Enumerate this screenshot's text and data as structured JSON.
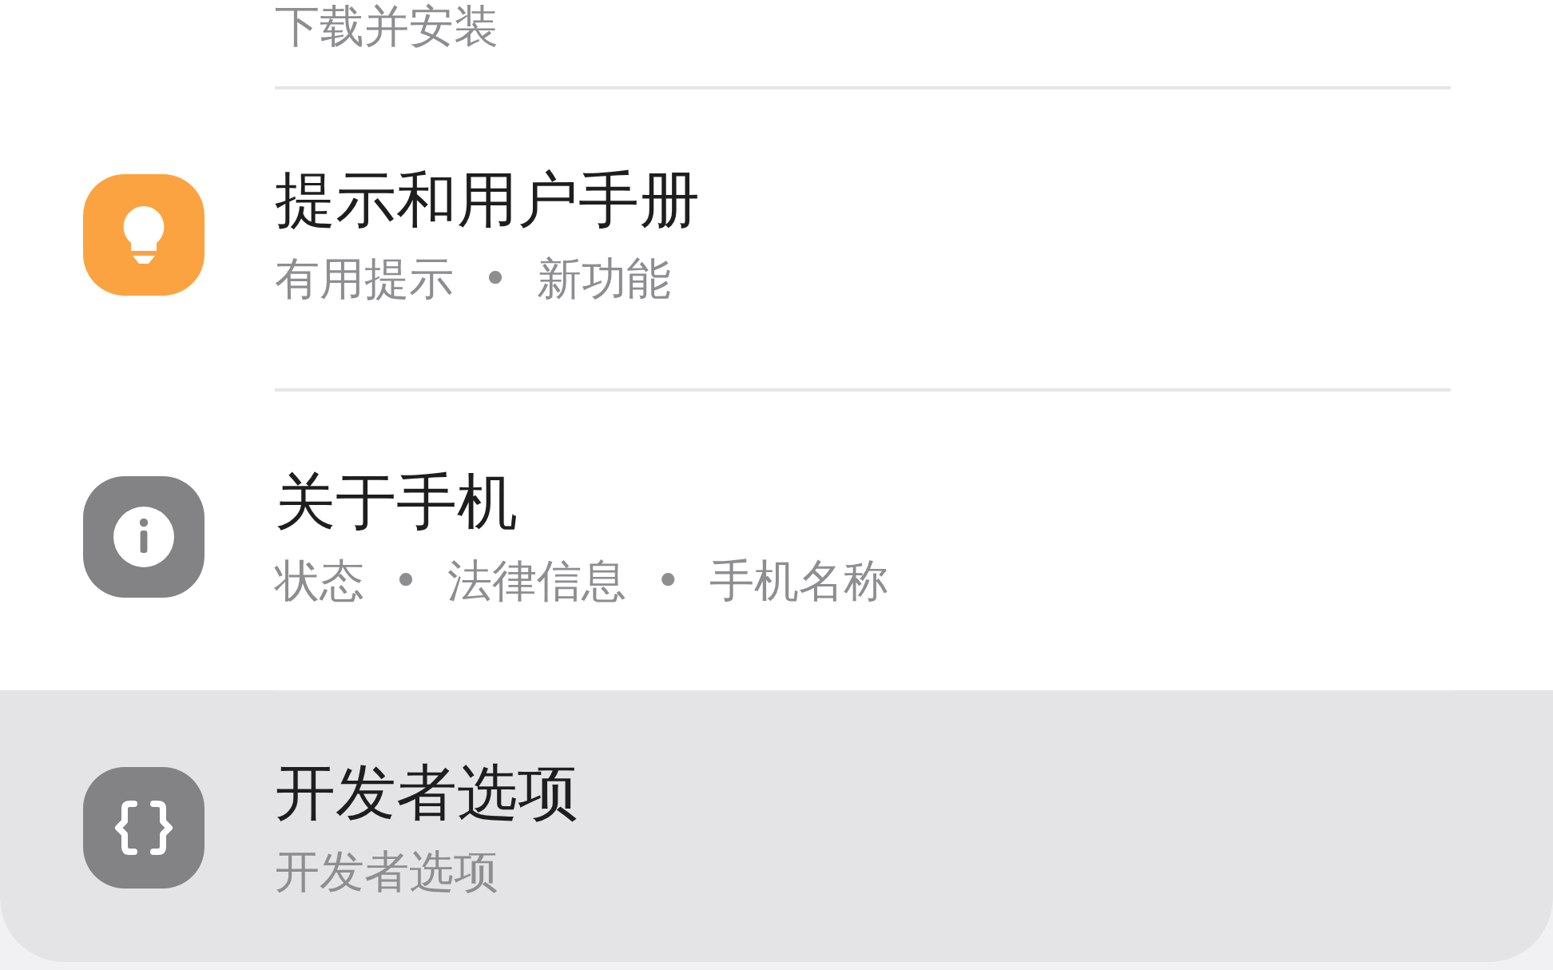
{
  "top_item": {
    "subtitle": "下载并安装"
  },
  "items": [
    {
      "kind": "tips",
      "color": "#fba340",
      "title": "提示和用户手册",
      "subtitle": "有用提示  •  新功能",
      "selected": false
    },
    {
      "kind": "about",
      "color": "#838386",
      "title": "关于手机",
      "subtitle": "状态  •  法律信息  •  手机名称",
      "selected": false
    },
    {
      "kind": "developer",
      "color": "#838386",
      "title": "开发者选项",
      "subtitle": "开发者选项",
      "selected": true
    }
  ]
}
